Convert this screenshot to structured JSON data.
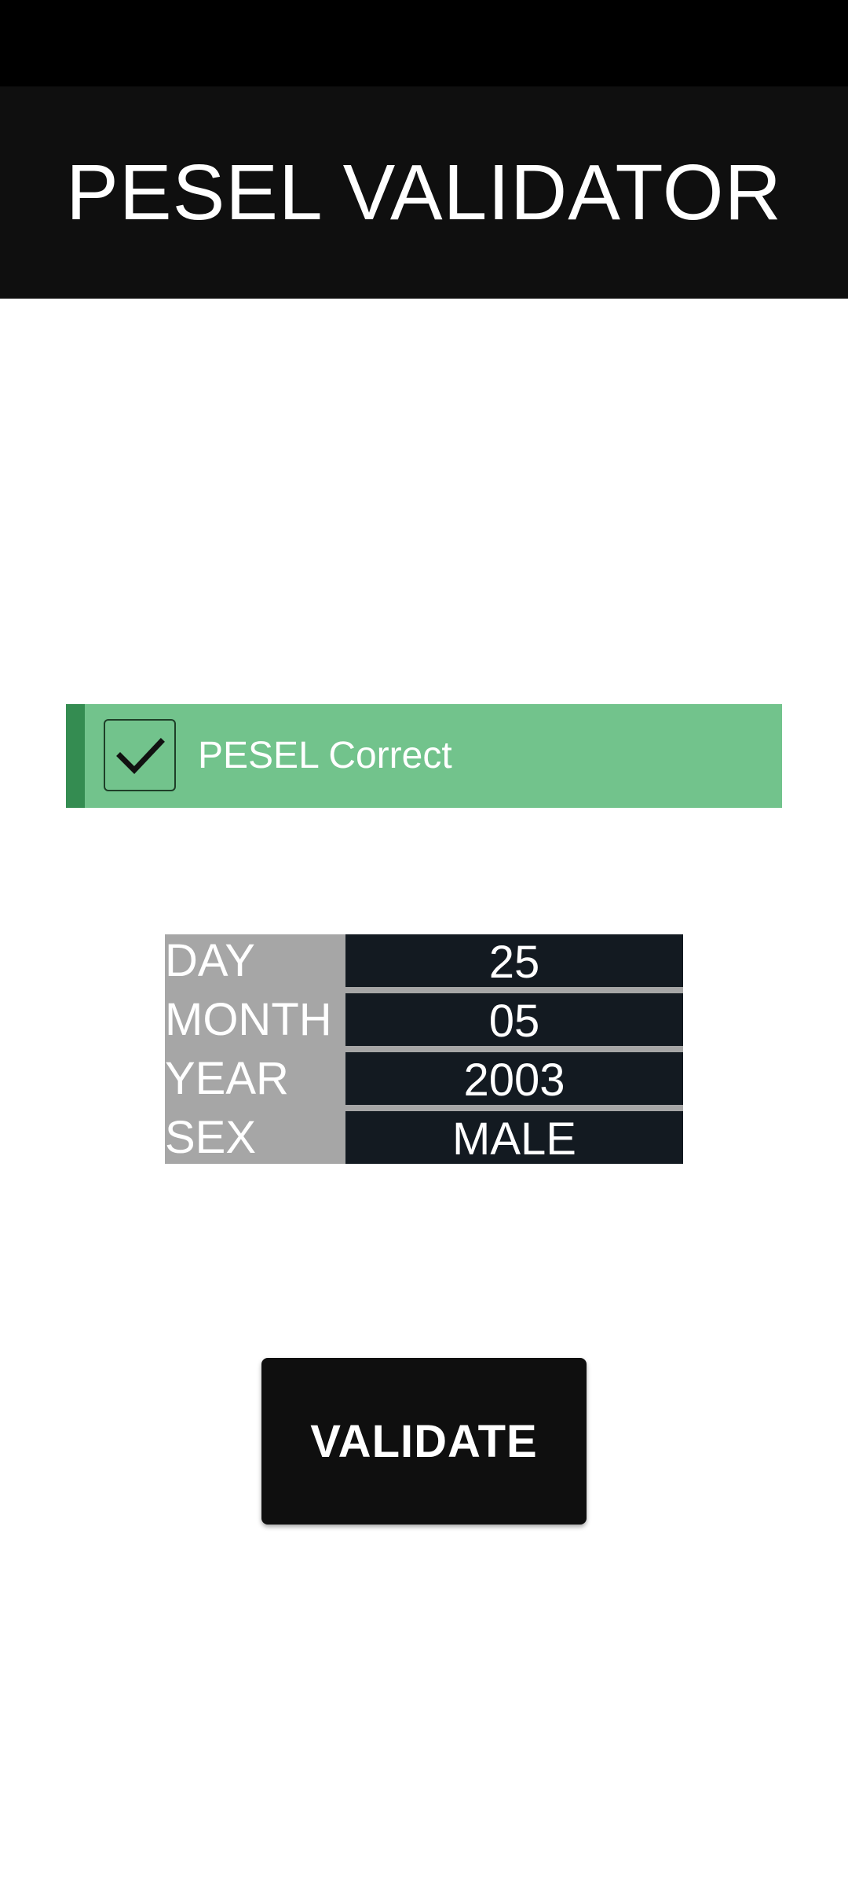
{
  "app": {
    "title": "PESEL VALIDATOR"
  },
  "result": {
    "status": "PESEL Correct",
    "icon": "check-icon",
    "colors": {
      "background": "#72c38c",
      "accent": "#348c51"
    }
  },
  "details": [
    {
      "label": "DAY",
      "value": "25"
    },
    {
      "label": "MONTH",
      "value": "05"
    },
    {
      "label": "YEAR",
      "value": "2003"
    },
    {
      "label": "SEX",
      "value": "MALE"
    }
  ],
  "actions": {
    "validate_label": "VALIDATE"
  }
}
